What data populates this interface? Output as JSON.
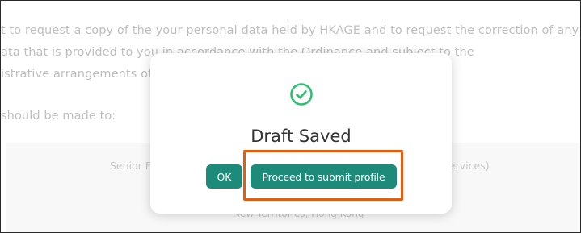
{
  "background": {
    "line1": "t to request a copy of the your personal data held by HKAGE and to request the correction of any inac",
    "line2": "ata that is provided to you in accordance with the Ordinance and subject to the",
    "line3": "istrative arrangements of",
    "line4": "should be made to:",
    "panel_label_left": "Senior F",
    "panel_label_right": "Services)",
    "panel_footer": "New Territories, Hong Kong"
  },
  "modal": {
    "icon": "check-circle-icon",
    "title": "Draft Saved",
    "ok_label": "OK",
    "proceed_label": "Proceed to submit profile"
  },
  "colors": {
    "accent": "#1d8a7a",
    "check": "#2fbf71",
    "highlight": "#e65c0f"
  }
}
